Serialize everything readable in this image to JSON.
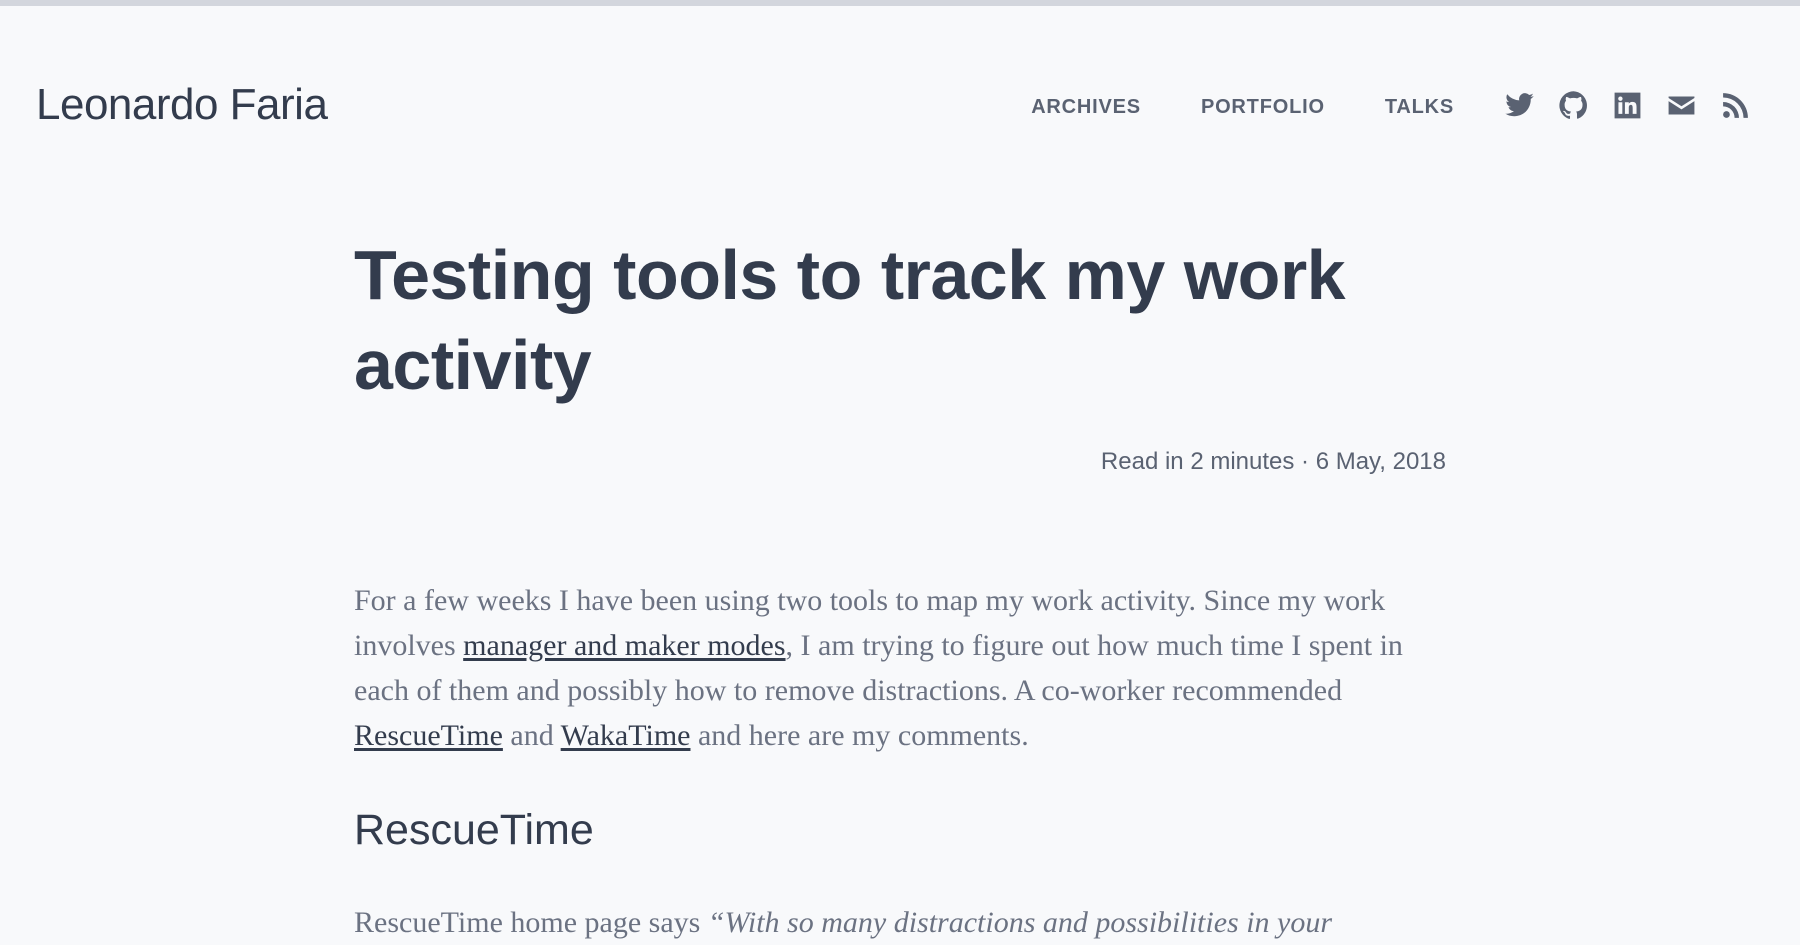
{
  "site": {
    "title": "Leonardo Faria"
  },
  "nav": {
    "items": [
      {
        "label": "ARCHIVES"
      },
      {
        "label": "PORTFOLIO"
      },
      {
        "label": "TALKS"
      }
    ]
  },
  "social": {
    "icons": [
      "twitter-icon",
      "github-icon",
      "linkedin-icon",
      "email-icon",
      "rss-icon"
    ]
  },
  "post": {
    "title": "Testing tools to track my work activity",
    "meta": "Read in 2 minutes · 6 May, 2018",
    "intro": {
      "t1": "For a few weeks I have been using two tools to map my work activity. Since my work involves ",
      "link1": "manager and maker modes",
      "t2": ", I am trying to figure out how much time I spent in each of them and possibly how to remove distractions. A co-worker recommended ",
      "link2": "RescueTime",
      "t3": " and ",
      "link3": "WakaTime",
      "t4": " and here are my comments."
    },
    "section_heading": "RescueTime",
    "para2": {
      "t1": "RescueTime home page says ",
      "quote": "“With so many distractions and possibilities in your"
    }
  },
  "colors": {
    "background": "#f8f9fb",
    "heading": "#333c4d",
    "body_text": "#6b7282",
    "nav": "#5a6272"
  }
}
